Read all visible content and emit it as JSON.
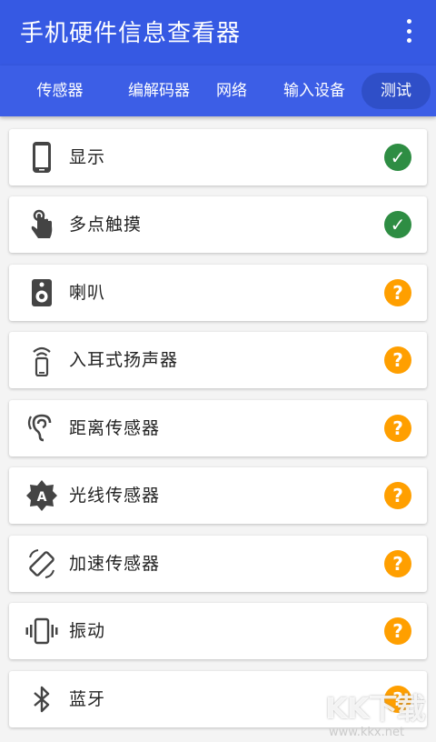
{
  "app": {
    "title": "手机硬件信息查看器",
    "overflow_icon": "more-vert-icon"
  },
  "colors": {
    "appbar": "#3659e3",
    "ok": "#2e8d43",
    "unknown": "#ff9f00"
  },
  "tabs": [
    {
      "label": "传感器",
      "active": false
    },
    {
      "label": "编解码器",
      "active": false
    },
    {
      "label": "网络",
      "active": false
    },
    {
      "label": "输入设备",
      "active": false
    },
    {
      "label": "测试",
      "active": true
    }
  ],
  "tests": [
    {
      "label": "显示",
      "icon": "phone-icon",
      "status": "ok",
      "status_glyph": "✓"
    },
    {
      "label": "多点触摸",
      "icon": "touch-icon",
      "status": "ok",
      "status_glyph": "✓"
    },
    {
      "label": "喇叭",
      "icon": "speaker-icon",
      "status": "unknown",
      "status_glyph": "?"
    },
    {
      "label": "入耳式扬声器",
      "icon": "earpiece-icon",
      "status": "unknown",
      "status_glyph": "?"
    },
    {
      "label": "距离传感器",
      "icon": "ear-icon",
      "status": "unknown",
      "status_glyph": "?"
    },
    {
      "label": "光线传感器",
      "icon": "brightness-auto-icon",
      "status": "unknown",
      "status_glyph": "?"
    },
    {
      "label": "加速传感器",
      "icon": "screen-rotation-icon",
      "status": "unknown",
      "status_glyph": "?"
    },
    {
      "label": "振动",
      "icon": "vibration-icon",
      "status": "unknown",
      "status_glyph": "?"
    },
    {
      "label": "蓝牙",
      "icon": "bluetooth-icon",
      "status": "unknown",
      "status_glyph": "?"
    }
  ],
  "watermark": {
    "brand": "KK下载",
    "site": "www.kkx.net"
  }
}
